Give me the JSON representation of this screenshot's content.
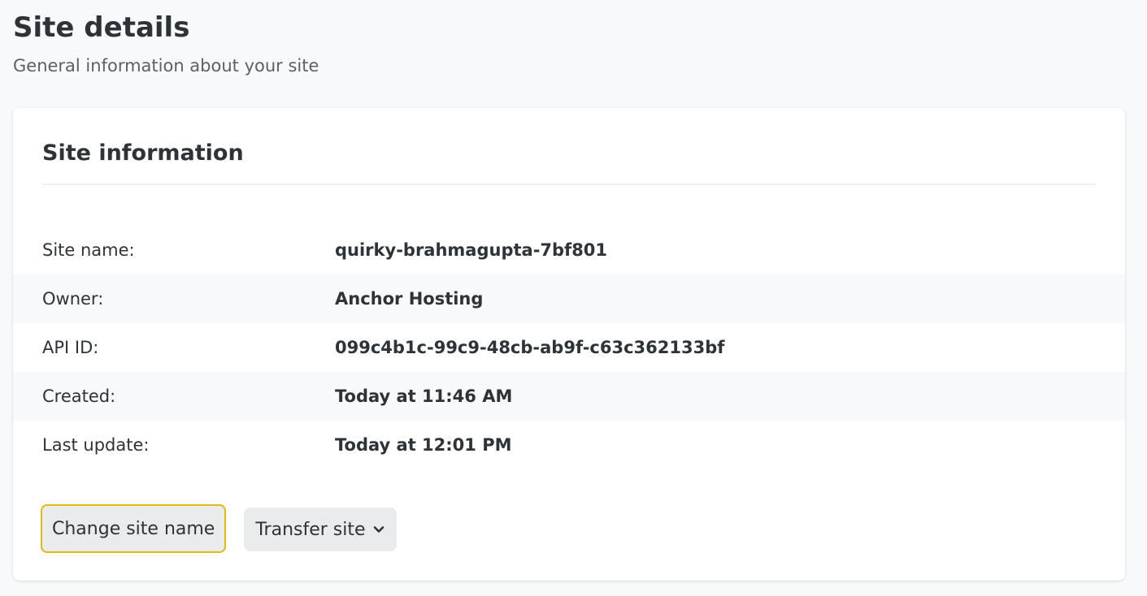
{
  "header": {
    "title": "Site details",
    "subtitle": "General information about your site"
  },
  "card": {
    "title": "Site information",
    "rows": [
      {
        "label": "Site name:",
        "value": "quirky-brahmagupta-7bf801"
      },
      {
        "label": "Owner:",
        "value": "Anchor Hosting"
      },
      {
        "label": "API ID:",
        "value": "099c4b1c-99c9-48cb-ab9f-c63c362133bf"
      },
      {
        "label": "Created:",
        "value": "Today at 11:46 AM"
      },
      {
        "label": "Last update:",
        "value": "Today at 12:01 PM"
      }
    ]
  },
  "actions": {
    "change_name_label": "Change site name",
    "transfer_label": "Transfer site",
    "transfer_icon": "chevron-down-icon"
  },
  "colors": {
    "page_bg": "#f7f9fa",
    "card_bg": "#ffffff",
    "text": "#2e3338",
    "focus_ring": "#e3b914",
    "button_bg": "#e9ebed"
  }
}
